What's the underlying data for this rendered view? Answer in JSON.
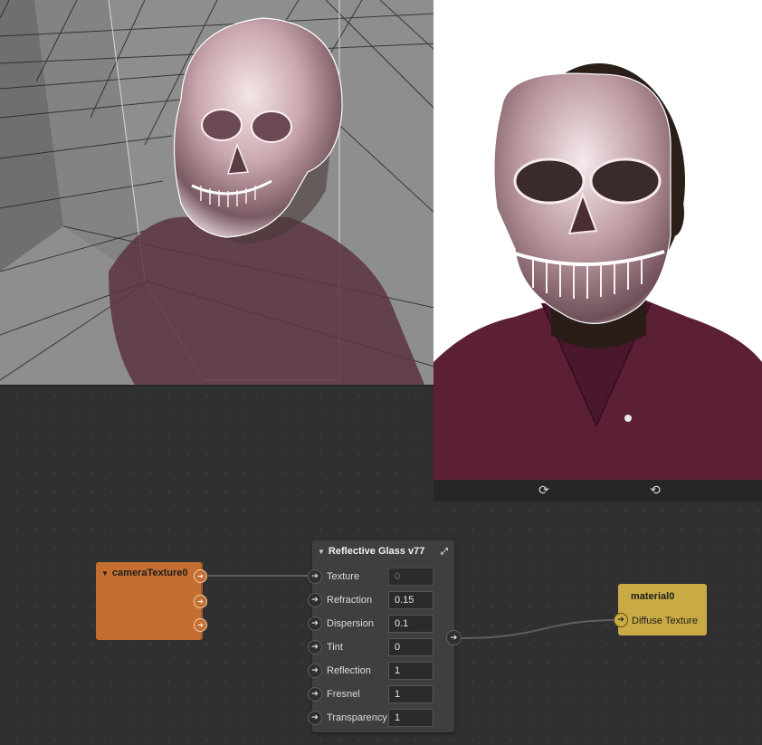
{
  "viewport": {
    "background": "#8e8e8e",
    "grid_color": "#1c1c1c"
  },
  "preview": {
    "toolbar": {
      "refresh_icon": "refresh-icon",
      "rotate_icon": "rotate-icon"
    }
  },
  "nodes": {
    "camera": {
      "title": "cameraTexture0",
      "color": "#c46f31",
      "outputs": 3
    },
    "glass": {
      "title": "Reflective Glass v77",
      "params": [
        {
          "label": "Texture",
          "value": "0"
        },
        {
          "label": "Refraction",
          "value": "0.15"
        },
        {
          "label": "Dispersion",
          "value": "0.1"
        },
        {
          "label": "Tint",
          "value": "0"
        },
        {
          "label": "Reflection",
          "value": "1"
        },
        {
          "label": "Fresnel",
          "value": "1"
        },
        {
          "label": "Transparency",
          "value": "1"
        }
      ]
    },
    "material": {
      "title": "material0",
      "port_label": "Diffuse Texture",
      "color": "#c9aa45"
    }
  },
  "connections": [
    {
      "from": "cameraTexture0.out0",
      "to": "Reflective Glass v77.Texture"
    },
    {
      "from": "Reflective Glass v77.out",
      "to": "material0.Diffuse Texture"
    }
  ]
}
